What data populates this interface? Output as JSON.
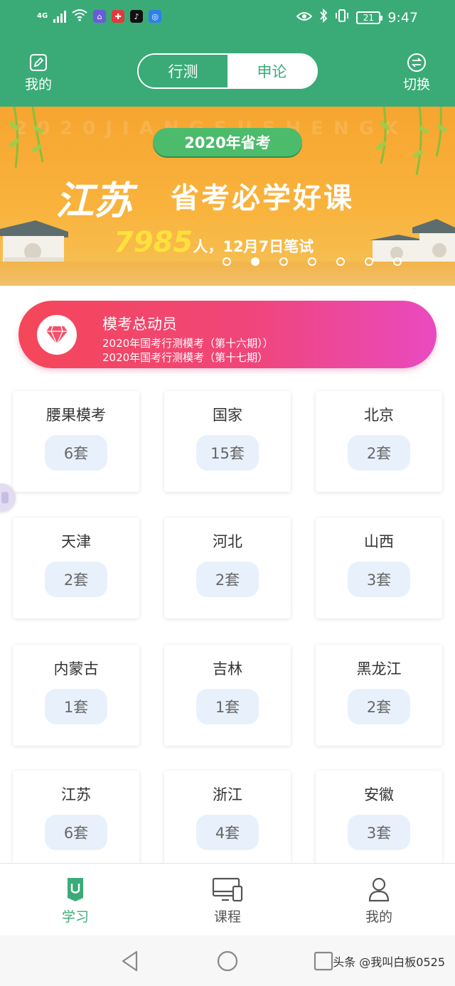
{
  "status_bar": {
    "network": "4G",
    "time": "9:47",
    "battery": "21"
  },
  "header": {
    "left_label": "我的",
    "right_label": "切换",
    "tabs": [
      {
        "label": "行测",
        "selected": false
      },
      {
        "label": "申论",
        "selected": true
      }
    ]
  },
  "banner": {
    "ghost_text": "2020JIANGSUSHENGK",
    "badge": "2020年省考",
    "title_big": "江苏",
    "title": "省考必学好课",
    "count": "7985",
    "subtitle": "人，12月7日笔试",
    "dots": 7,
    "active_dot": 1
  },
  "mock_exam": {
    "title": "模考总动员",
    "line1": "2020年国考行测模考（第十六期））",
    "line2": "2020年国考行测模考（第十七期）"
  },
  "regions": [
    {
      "name": "腰果模考",
      "count": "6套"
    },
    {
      "name": "国家",
      "count": "15套"
    },
    {
      "name": "北京",
      "count": "2套"
    },
    {
      "name": "天津",
      "count": "2套"
    },
    {
      "name": "河北",
      "count": "2套"
    },
    {
      "name": "山西",
      "count": "3套"
    },
    {
      "name": "内蒙古",
      "count": "1套"
    },
    {
      "name": "吉林",
      "count": "1套"
    },
    {
      "name": "黑龙江",
      "count": "2套"
    },
    {
      "name": "江苏",
      "count": "6套"
    },
    {
      "name": "浙江",
      "count": "4套"
    },
    {
      "name": "安徽",
      "count": "3套"
    }
  ],
  "bottom_nav": [
    {
      "label": "学习",
      "active": true
    },
    {
      "label": "课程",
      "active": false
    },
    {
      "label": "我的",
      "active": false
    }
  ],
  "watermark": "头条 @我叫白板0525",
  "colors": {
    "brand_green": "#3aab77",
    "banner_orange": "#f6a530",
    "mock_gradient_start": "#f54759",
    "mock_gradient_end": "#e94ac0",
    "count_pill_bg": "#e8f1fb"
  }
}
